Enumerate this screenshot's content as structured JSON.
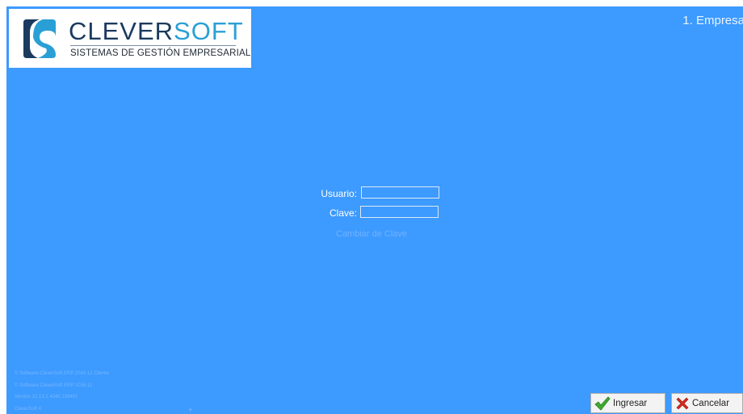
{
  "logo": {
    "brand_main": "CLEVER",
    "brand_accent": "SOFT",
    "tagline": "SISTEMAS DE GESTIÓN EMPRESARIAL"
  },
  "header": {
    "company": "1. Empresa"
  },
  "login": {
    "user_label": "Usuario:",
    "user_value": "",
    "password_label": "Clave:",
    "password_value": "",
    "change_password_link": "Cambiar de Clave"
  },
  "footer": {
    "line1": "© Software CleverSoft ERP 2016.12 Cliente",
    "line2": "© Software CleverSoft ERP 2016.11",
    "line3": "Versión 10.13.1.4040 129497",
    "line4": "CleverSoft 4"
  },
  "actions": {
    "login_label": "Ingresar",
    "cancel_label": "Cancelar"
  },
  "colors": {
    "background": "#3d9aff",
    "brand_dark": "#1b3a5e",
    "brand_accent": "#2a9fd6",
    "ok": "#3dab2e",
    "cancel": "#d42a1f"
  }
}
